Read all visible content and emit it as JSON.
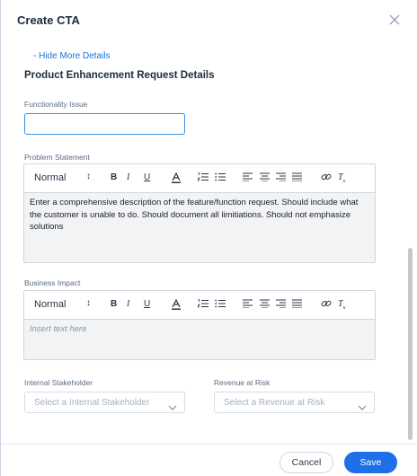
{
  "dialog": {
    "title": "Create CTA"
  },
  "details": {
    "toggle_link": "- Hide More Details",
    "section_title": "Product Enhancement Request Details"
  },
  "fields": {
    "functionality_issue": {
      "label": "Functionality Issue",
      "value": ""
    },
    "problem_statement": {
      "label": "Problem Statement",
      "toolbar": {
        "format": "Normal",
        "format_caret": "↕"
      },
      "content": "Enter a comprehensive description of the feature/function request. Should include what the customer is unable to do. Should document all limitiations. Should not emphasize solutions"
    },
    "business_impact": {
      "label": "Business Impact",
      "toolbar": {
        "format": "Normal",
        "format_caret": "↕"
      },
      "placeholder": "Insert text here"
    },
    "internal_stakeholder": {
      "label": "Internal Stakeholder",
      "placeholder": "Select a Internal Stakeholder"
    },
    "revenue_at_risk": {
      "label": "Revenue at Risk",
      "placeholder": "Select a Revenue at Risk"
    }
  },
  "footer": {
    "cancel_label": "Cancel",
    "save_label": "Save"
  },
  "icons": {
    "close": "close-icon",
    "bold": "bold-icon",
    "italic": "italic-icon",
    "underline": "underline-icon",
    "color": "text-color-icon",
    "ordered": "ordered-list-icon",
    "bullet": "bullet-list-icon",
    "align": "align-icon",
    "link": "link-icon",
    "clear": "clear-format-icon",
    "chevron": "chevron-down-icon"
  },
  "colors": {
    "accent": "#1e6fe8",
    "link": "#1a73d9",
    "focus_border": "#3b8fe4"
  }
}
